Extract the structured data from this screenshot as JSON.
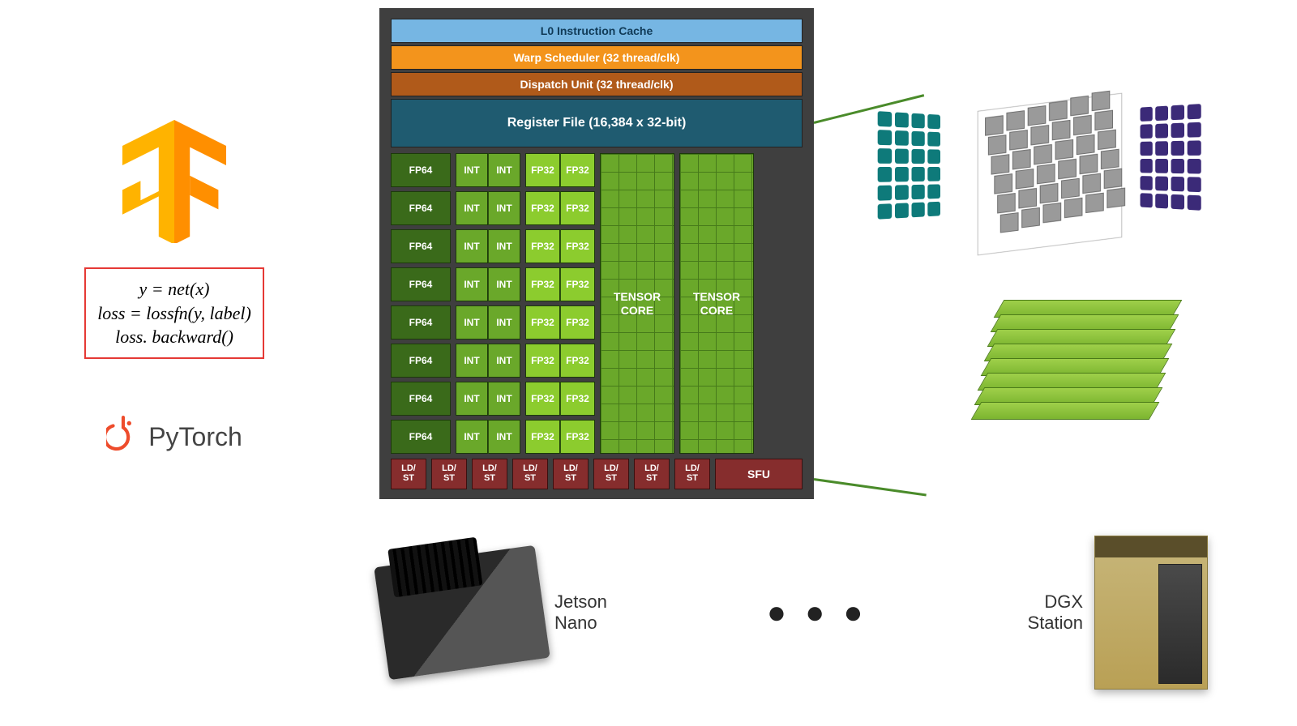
{
  "left": {
    "tf_logo_alt": "TensorFlow",
    "code_lines": [
      "y = net(x)",
      "loss = lossfn(y, label)",
      "loss. backward()"
    ],
    "pytorch_label": "PyTorch"
  },
  "sm": {
    "l0": "L0 Instruction Cache",
    "warp": "Warp Scheduler (32 thread/clk)",
    "dispatch": "Dispatch Unit (32 thread/clk)",
    "regfile": "Register File (16,384 x 32-bit)",
    "fp64": "FP64",
    "int": "INT",
    "fp32": "FP32",
    "tensor_core": "TENSOR CORE",
    "ldst": "LD/\nST",
    "sfu": "SFU",
    "rows": 8,
    "ldst_count": 8
  },
  "hardware": {
    "jetson": "Jetson\nNano",
    "ellipsis": "● ● ●",
    "dgx": "DGX\nStation"
  }
}
